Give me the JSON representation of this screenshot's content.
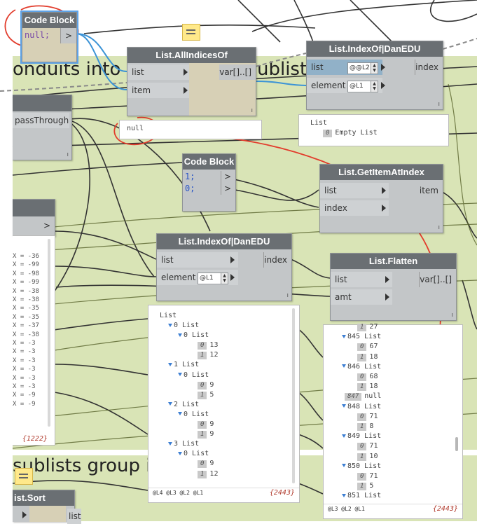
{
  "groups": {
    "conduits_title": "onduits into a",
    "conduits_title_tail": "ublists",
    "sublists_title": "sublists group i"
  },
  "nodes": {
    "codeblock_null": {
      "title": "Code Block",
      "code": "null;",
      "out": ">"
    },
    "allindicesof": {
      "title": "List.AllIndicesOf",
      "in1": "list",
      "in2": "item",
      "out": "var[]..[]",
      "preview": "null"
    },
    "indexof_top": {
      "title": "List.IndexOf|DanEDU",
      "in1": "list",
      "in2": "element",
      "spin1": "@@L2",
      "spin2": "@L1",
      "out": "index"
    },
    "empty_list_preview": {
      "header": "List",
      "row_index": "0",
      "row_value": "Empty List"
    },
    "passthrough": {
      "in": "passThrough"
    },
    "codeblock_01": {
      "title": "Code Block",
      "line1": "1;",
      "line2": "0;",
      "out1": ">",
      "out2": ">"
    },
    "getitem": {
      "title": "List.GetItemAtIndex",
      "in1": "list",
      "in2": "index",
      "out": "item"
    },
    "indexof_mid": {
      "title": "List.IndexOf|DanEDU",
      "in1": "list",
      "in2": "element",
      "spin2": "@L1",
      "out": "index"
    },
    "flatten": {
      "title": "List.Flatten",
      "in1": "list",
      "in2": "amt",
      "out": "var[]..[]"
    },
    "left_partial": {
      "out": ">",
      "count": "{1222}"
    },
    "sort_partial": {
      "title": "ist.Sort",
      "in": "list"
    }
  },
  "left_values": [
    "X = -36",
    "X = -99",
    "X = -98",
    "X = -99",
    "X = -38",
    "X = -38",
    "X = -35",
    "X = -35",
    "X = -37",
    "X = -38",
    "X = -3",
    "X = -3",
    "X = -3",
    "X = -3",
    "X = -3",
    "X = -3",
    "X = -9",
    "X = -9"
  ],
  "mid_preview": {
    "root": "List",
    "tree": [
      {
        "label": "0 List"
      },
      {
        "label": "0 List"
      },
      {
        "idx": "0",
        "val": "13"
      },
      {
        "idx": "1",
        "val": "12"
      },
      {
        "label": "1 List"
      },
      {
        "label": "0 List"
      },
      {
        "idx": "0",
        "val": "9"
      },
      {
        "idx": "1",
        "val": "5"
      },
      {
        "label": "2 List"
      },
      {
        "label": "0 List"
      },
      {
        "idx": "0",
        "val": "9"
      },
      {
        "idx": "1",
        "val": "9"
      },
      {
        "label": "3 List"
      },
      {
        "label": "0 List"
      },
      {
        "idx": "0",
        "val": "9"
      },
      {
        "idx": "1",
        "val": "12"
      }
    ],
    "levels": "@L4 @L3 @L2 @L1",
    "count": "{2443}"
  },
  "flatten_preview": {
    "tree": [
      {
        "idx": "1",
        "val": "27"
      },
      {
        "label": "845 List"
      },
      {
        "idx": "0",
        "val": "67"
      },
      {
        "idx": "1",
        "val": "18"
      },
      {
        "label": "846 List"
      },
      {
        "idx": "0",
        "val": "68"
      },
      {
        "idx": "1",
        "val": "18"
      },
      {
        "idx": "847",
        "val": "null"
      },
      {
        "label": "848 List"
      },
      {
        "idx": "0",
        "val": "71"
      },
      {
        "idx": "1",
        "val": "8"
      },
      {
        "label": "849 List"
      },
      {
        "idx": "0",
        "val": "71"
      },
      {
        "idx": "1",
        "val": "10"
      },
      {
        "label": "850 List"
      },
      {
        "idx": "0",
        "val": "71"
      },
      {
        "idx": "1",
        "val": "5"
      },
      {
        "label": "851 List"
      }
    ],
    "levels": "@L3 @L2 @L1",
    "count": "{2443}"
  }
}
